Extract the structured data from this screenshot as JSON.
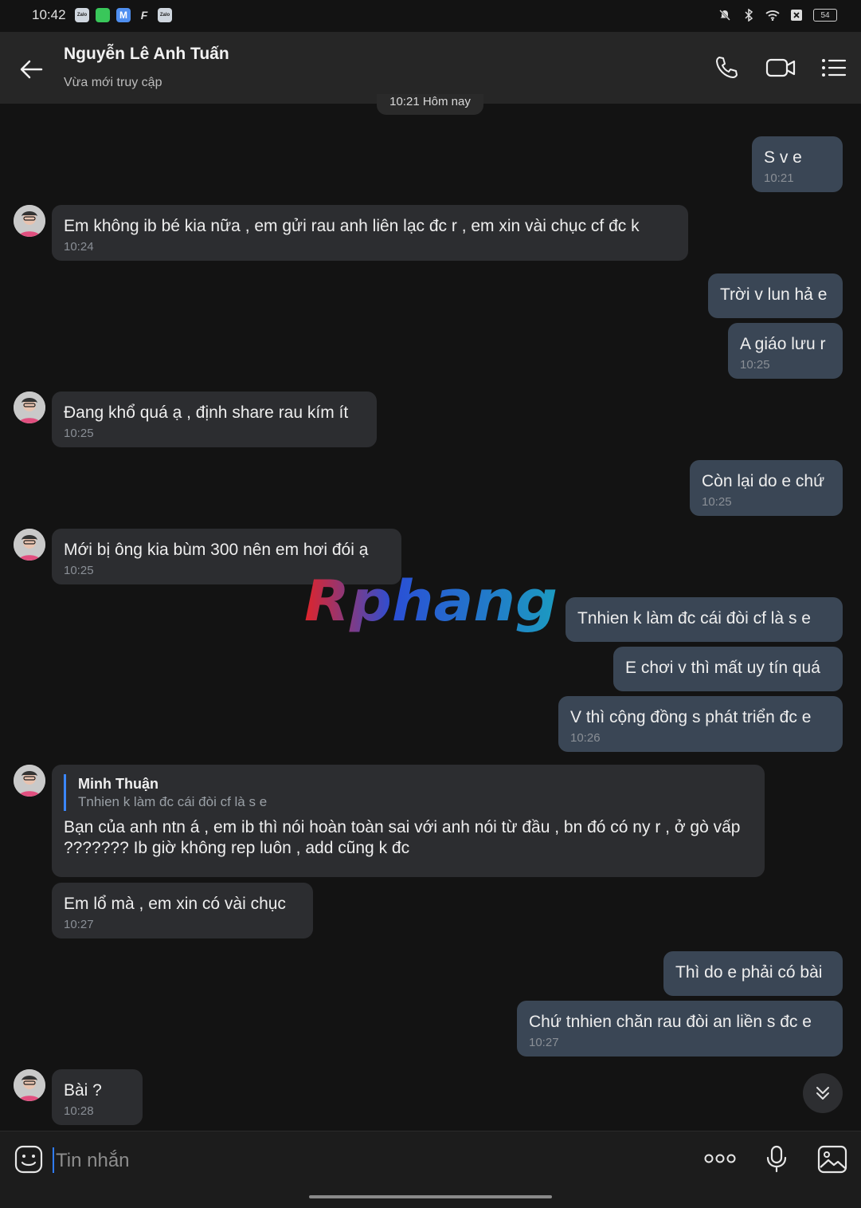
{
  "status_bar": {
    "time": "10:42",
    "apps": [
      "Zalo",
      "",
      "M",
      "F",
      "Zalo"
    ],
    "battery": "54"
  },
  "header": {
    "contact_name": "Nguyễn Lê Anh Tuấn",
    "status": "Vừa mới truy cập"
  },
  "date_separator": "10:21 Hôm nay",
  "messages": [
    {
      "dir": "out",
      "text": "S v e",
      "time": "10:21"
    },
    {
      "dir": "in",
      "text": "Em không ib bé kia nữa , em gửi rau anh liên lạc đc r , em xin vài chục cf đc k",
      "time": "10:24"
    },
    {
      "dir": "out",
      "text": "Trời v lun hả e",
      "time": ""
    },
    {
      "dir": "out",
      "text": "A giáo lưu r",
      "time": "10:25"
    },
    {
      "dir": "in",
      "text": "Đang khổ quá ạ , định share rau kím ít",
      "time": "10:25"
    },
    {
      "dir": "out",
      "text": "Còn lại do e chứ",
      "time": "10:25"
    },
    {
      "dir": "in",
      "text": "Mới bị ông kia bùm 300 nên em hơi đói ạ",
      "time": "10:25"
    },
    {
      "dir": "out",
      "text": "Tnhien k làm đc cái đòi cf là s e",
      "time": ""
    },
    {
      "dir": "out",
      "text": "E chơi v thì mất uy tín quá",
      "time": ""
    },
    {
      "dir": "out",
      "text": "V thì cộng đồng s phát triển đc e",
      "time": "10:26"
    },
    {
      "dir": "in",
      "quote_name": "Minh Thuận",
      "quote_text": "Tnhien k làm đc cái đòi cf là s e",
      "text": "Bạn của anh ntn á , em ib thì nói hoàn toàn sai với anh nói từ đầu , bn đó có ny r , ở gò vấp ??????? Ib giờ không rep luôn , add cũng k đc",
      "time": ""
    },
    {
      "dir": "in",
      "text": "Em lổ mà , em xin có vài chục",
      "time": "10:27"
    },
    {
      "dir": "out",
      "text": "Thì do e phải có bài",
      "time": ""
    },
    {
      "dir": "out",
      "text": "Chứ tnhien chăn rau đòi an liền s đc e",
      "time": "10:27"
    },
    {
      "dir": "in",
      "text": "Bài ?",
      "time": "10:28"
    }
  ],
  "watermark": "Rphang",
  "composer": {
    "placeholder": "Tin nhắn"
  },
  "colors": {
    "background": "#131313",
    "header": "#262626",
    "incoming_bubble": "#2c2d30",
    "outgoing_bubble": "#3a4655",
    "caret": "#2f7cff",
    "quote_bar": "#3b87ff"
  }
}
